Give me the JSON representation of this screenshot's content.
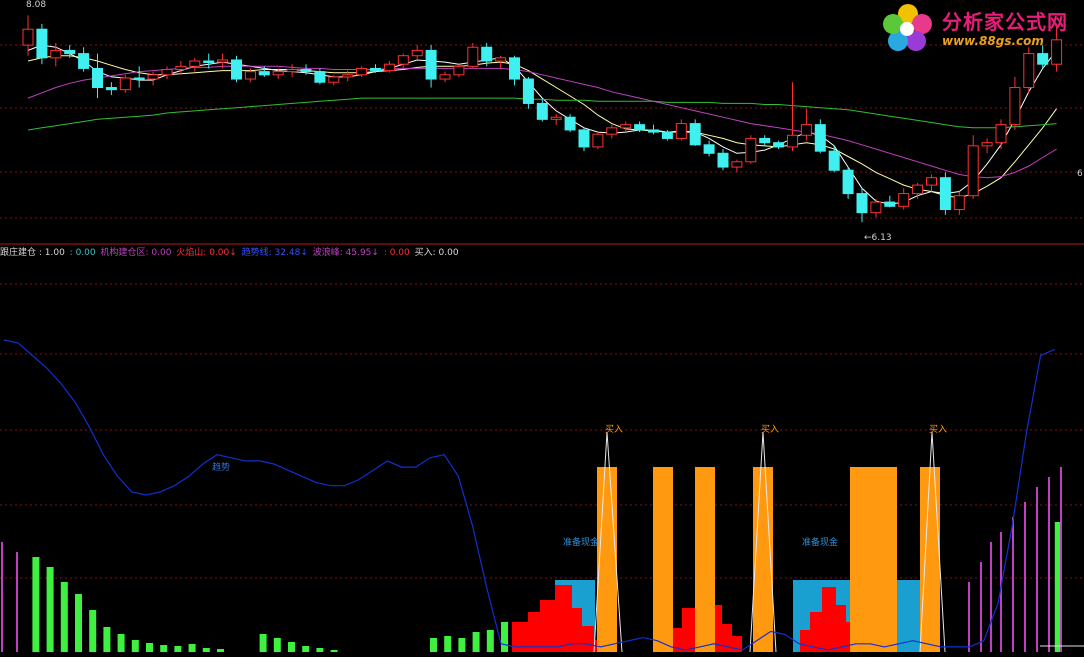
{
  "colors": {
    "up_candle": "#ff3030",
    "down_candle": "#40f0f0",
    "ma5": "#ffffff",
    "ma10": "#ffffaa",
    "ma30": "#c040c0",
    "ma60": "#30c030",
    "gridline": "#8a1010",
    "blue_line": "#1030d0",
    "orange": "#ff9a10",
    "cyan_fill": "#1aa0d0",
    "red_fill": "#ff0000",
    "green_bar": "#40f040",
    "magenta_bar": "#c040c0"
  },
  "price_panel": {
    "high_label": "8.08",
    "low_label": "6.13",
    "right_tick": "6"
  },
  "legend": [
    {
      "text": "跟庄建仓 : 1.00",
      "color": "#d8d8d8"
    },
    {
      "text": ": 0.00",
      "color": "#40c0c0"
    },
    {
      "text": "机构建仓区: 0.00",
      "color": "#c040c0"
    },
    {
      "text": "火焰山: 0.00↓",
      "color": "#ff3030"
    },
    {
      "text": "趋势线: 32.48↓",
      "color": "#3050ff"
    },
    {
      "text": "波浪峰: 45.95↓",
      "color": "#c040c0"
    },
    {
      "text": ": 0.00",
      "color": "#ff3030"
    },
    {
      "text": "买入: 0.00",
      "color": "#d8d8d8"
    }
  ],
  "annotations": {
    "buy_label": "买入",
    "cash_label": "准备现金",
    "trend_label": "趋势"
  },
  "logo": {
    "title": "分析家公式网",
    "url": "www.88gs.com"
  },
  "chart_data": [
    {
      "type": "candlestick",
      "title": "",
      "ylim": [
        6.0,
        8.15
      ],
      "x": [
        0,
        1,
        2,
        3,
        4,
        5,
        6,
        7,
        8,
        9,
        10,
        11,
        12,
        13,
        14,
        15,
        16,
        17,
        18,
        19,
        20,
        21,
        22,
        23,
        24,
        25,
        26,
        27,
        28,
        29,
        30,
        31,
        32,
        33,
        34,
        35,
        36,
        37,
        38,
        39,
        40,
        41,
        42,
        43,
        44,
        45,
        46,
        47,
        48,
        49,
        50,
        51,
        52,
        53,
        54,
        55,
        56,
        57,
        58,
        59,
        60,
        61,
        62,
        63,
        64,
        65,
        66,
        67,
        68,
        69,
        70,
        71,
        72,
        73,
        74
      ],
      "ohlc": [
        [
          7.8,
          8.08,
          7.7,
          7.95
        ],
        [
          7.95,
          8.0,
          7.62,
          7.68
        ],
        [
          7.68,
          7.82,
          7.6,
          7.75
        ],
        [
          7.75,
          7.8,
          7.68,
          7.72
        ],
        [
          7.72,
          7.78,
          7.55,
          7.58
        ],
        [
          7.58,
          7.72,
          7.3,
          7.4
        ],
        [
          7.4,
          7.45,
          7.33,
          7.38
        ],
        [
          7.38,
          7.52,
          7.35,
          7.49
        ],
        [
          7.49,
          7.6,
          7.4,
          7.48
        ],
        [
          7.48,
          7.55,
          7.42,
          7.52
        ],
        [
          7.52,
          7.6,
          7.48,
          7.57
        ],
        [
          7.57,
          7.65,
          7.52,
          7.6
        ],
        [
          7.6,
          7.68,
          7.55,
          7.65
        ],
        [
          7.65,
          7.72,
          7.58,
          7.64
        ],
        [
          7.64,
          7.72,
          7.58,
          7.66
        ],
        [
          7.66,
          7.7,
          7.45,
          7.48
        ],
        [
          7.48,
          7.58,
          7.45,
          7.55
        ],
        [
          7.55,
          7.6,
          7.5,
          7.52
        ],
        [
          7.52,
          7.58,
          7.48,
          7.55
        ],
        [
          7.55,
          7.62,
          7.5,
          7.57
        ],
        [
          7.57,
          7.62,
          7.52,
          7.55
        ],
        [
          7.55,
          7.58,
          7.43,
          7.45
        ],
        [
          7.45,
          7.52,
          7.42,
          7.5
        ],
        [
          7.5,
          7.56,
          7.46,
          7.52
        ],
        [
          7.52,
          7.6,
          7.5,
          7.58
        ],
        [
          7.58,
          7.62,
          7.54,
          7.56
        ],
        [
          7.56,
          7.65,
          7.54,
          7.62
        ],
        [
          7.62,
          7.72,
          7.58,
          7.7
        ],
        [
          7.7,
          7.8,
          7.66,
          7.75
        ],
        [
          7.75,
          7.8,
          7.4,
          7.48
        ],
        [
          7.48,
          7.55,
          7.45,
          7.52
        ],
        [
          7.52,
          7.62,
          7.5,
          7.6
        ],
        [
          7.6,
          7.82,
          7.58,
          7.78
        ],
        [
          7.78,
          7.82,
          7.6,
          7.65
        ],
        [
          7.65,
          7.7,
          7.58,
          7.68
        ],
        [
          7.68,
          7.7,
          7.42,
          7.48
        ],
        [
          7.48,
          7.5,
          7.2,
          7.25
        ],
        [
          7.25,
          7.3,
          7.08,
          7.1
        ],
        [
          7.1,
          7.15,
          7.05,
          7.12
        ],
        [
          7.12,
          7.15,
          6.98,
          7.0
        ],
        [
          7.0,
          7.02,
          6.8,
          6.84
        ],
        [
          6.84,
          6.98,
          6.82,
          6.96
        ],
        [
          6.96,
          7.05,
          6.92,
          7.02
        ],
        [
          7.02,
          7.08,
          6.98,
          7.05
        ],
        [
          7.05,
          7.08,
          6.98,
          7.0
        ],
        [
          7.0,
          7.05,
          6.96,
          6.98
        ],
        [
          6.98,
          7.0,
          6.9,
          6.92
        ],
        [
          6.92,
          7.1,
          6.9,
          7.06
        ],
        [
          7.06,
          7.1,
          6.85,
          6.86
        ],
        [
          6.86,
          6.9,
          6.75,
          6.78
        ],
        [
          6.78,
          6.82,
          6.62,
          6.65
        ],
        [
          6.65,
          6.72,
          6.6,
          6.7
        ],
        [
          6.7,
          6.95,
          6.68,
          6.92
        ],
        [
          6.92,
          6.95,
          6.85,
          6.88
        ],
        [
          6.88,
          6.9,
          6.82,
          6.84
        ],
        [
          6.84,
          7.45,
          6.8,
          6.95
        ],
        [
          6.95,
          7.2,
          6.9,
          7.05
        ],
        [
          7.05,
          7.1,
          6.78,
          6.8
        ],
        [
          6.8,
          6.85,
          6.6,
          6.62
        ],
        [
          6.62,
          6.65,
          6.35,
          6.4
        ],
        [
          6.4,
          6.45,
          6.13,
          6.22
        ],
        [
          6.22,
          6.35,
          6.18,
          6.32
        ],
        [
          6.32,
          6.38,
          6.27,
          6.28
        ],
        [
          6.28,
          6.45,
          6.25,
          6.4
        ],
        [
          6.4,
          6.5,
          6.35,
          6.48
        ],
        [
          6.48,
          6.58,
          6.42,
          6.55
        ],
        [
          6.55,
          6.6,
          6.2,
          6.25
        ],
        [
          6.25,
          6.42,
          6.2,
          6.38
        ],
        [
          6.38,
          6.95,
          6.35,
          6.85
        ],
        [
          6.85,
          6.92,
          6.78,
          6.88
        ],
        [
          6.88,
          7.1,
          6.82,
          7.05
        ],
        [
          7.05,
          7.5,
          7.0,
          7.4
        ],
        [
          7.4,
          7.78,
          7.35,
          7.72
        ],
        [
          7.72,
          7.8,
          7.58,
          7.62
        ],
        [
          7.62,
          8.0,
          7.55,
          7.85
        ]
      ],
      "series": [
        {
          "name": "",
          "values": [
            7.75,
            7.8,
            7.78,
            7.72,
            7.65,
            7.55,
            7.5,
            7.49,
            7.47,
            7.47,
            7.52,
            7.56,
            7.6,
            7.62,
            7.64,
            7.62,
            7.6,
            7.58,
            7.56,
            7.55,
            7.54,
            7.52,
            7.5,
            7.5,
            7.52,
            7.55,
            7.58,
            7.62,
            7.66,
            7.65,
            7.64,
            7.62,
            7.64,
            7.66,
            7.68,
            7.6,
            7.45,
            7.3,
            7.18,
            7.1,
            7.02,
            6.98,
            6.97,
            6.98,
            7.0,
            7.0,
            6.98,
            6.99,
            6.98,
            6.92,
            6.84,
            6.78,
            6.79,
            6.81,
            6.86,
            6.92,
            6.98,
            6.95,
            6.85,
            6.65,
            6.45,
            6.33,
            6.3,
            6.32,
            6.38,
            6.42,
            6.4,
            6.42,
            6.52,
            6.68,
            6.86,
            7.1,
            7.36,
            7.58,
            7.75
          ]
        },
        {
          "name": "",
          "values": [
            7.65,
            7.68,
            7.7,
            7.7,
            7.68,
            7.65,
            7.61,
            7.57,
            7.54,
            7.52,
            7.52,
            7.53,
            7.54,
            7.55,
            7.56,
            7.56,
            7.56,
            7.57,
            7.57,
            7.57,
            7.56,
            7.55,
            7.54,
            7.54,
            7.54,
            7.55,
            7.56,
            7.57,
            7.59,
            7.6,
            7.6,
            7.6,
            7.61,
            7.63,
            7.64,
            7.62,
            7.56,
            7.48,
            7.4,
            7.32,
            7.24,
            7.14,
            7.06,
            7.01,
            7.0,
            6.99,
            6.98,
            6.98,
            6.98,
            6.95,
            6.92,
            6.88,
            6.86,
            6.85,
            6.84,
            6.86,
            6.88,
            6.86,
            6.82,
            6.75,
            6.68,
            6.6,
            6.54,
            6.48,
            6.44,
            6.42,
            6.38,
            6.36,
            6.4,
            6.47,
            6.55,
            6.7,
            6.86,
            7.02,
            7.2
          ]
        },
        {
          "name": "",
          "values": [
            7.3,
            7.35,
            7.4,
            7.44,
            7.47,
            7.49,
            7.51,
            7.53,
            7.55,
            7.56,
            7.57,
            7.58,
            7.59,
            7.59,
            7.6,
            7.6,
            7.6,
            7.6,
            7.6,
            7.59,
            7.58,
            7.58,
            7.57,
            7.57,
            7.57,
            7.57,
            7.58,
            7.58,
            7.58,
            7.58,
            7.58,
            7.58,
            7.58,
            7.58,
            7.58,
            7.57,
            7.55,
            7.52,
            7.49,
            7.46,
            7.43,
            7.4,
            7.36,
            7.33,
            7.3,
            7.27,
            7.24,
            7.21,
            7.18,
            7.15,
            7.12,
            7.09,
            7.06,
            7.04,
            7.02,
            7.0,
            6.98,
            6.96,
            6.93,
            6.9,
            6.86,
            6.82,
            6.78,
            6.74,
            6.7,
            6.66,
            6.62,
            6.58,
            6.56,
            6.55,
            6.56,
            6.6,
            6.66,
            6.74,
            6.82
          ]
        },
        {
          "name": "",
          "values": [
            7.0,
            7.02,
            7.04,
            7.06,
            7.08,
            7.1,
            7.11,
            7.12,
            7.13,
            7.14,
            7.16,
            7.17,
            7.18,
            7.19,
            7.2,
            7.21,
            7.22,
            7.23,
            7.24,
            7.25,
            7.26,
            7.27,
            7.28,
            7.29,
            7.3,
            7.3,
            7.3,
            7.3,
            7.3,
            7.3,
            7.3,
            7.3,
            7.3,
            7.3,
            7.3,
            7.3,
            7.29,
            7.29,
            7.28,
            7.28,
            7.28,
            7.27,
            7.27,
            7.27,
            7.27,
            7.27,
            7.26,
            7.26,
            7.26,
            7.26,
            7.25,
            7.25,
            7.25,
            7.24,
            7.24,
            7.23,
            7.22,
            7.21,
            7.2,
            7.19,
            7.17,
            7.15,
            7.13,
            7.11,
            7.09,
            7.07,
            7.05,
            7.03,
            7.02,
            7.02,
            7.02,
            7.03,
            7.04,
            7.05,
            7.06
          ]
        }
      ]
    },
    {
      "type": "area",
      "title": "",
      "ylim": [
        0,
        100
      ],
      "x": [
        0,
        1,
        2,
        3,
        4,
        5,
        6,
        7,
        8,
        9,
        10,
        11,
        12,
        13,
        14,
        15,
        16,
        17,
        18,
        19,
        20,
        21,
        22,
        23,
        24,
        25,
        26,
        27,
        28,
        29,
        30,
        31,
        32,
        33,
        34,
        35,
        36,
        37,
        38,
        39,
        40,
        41,
        42,
        43,
        44,
        45,
        46,
        47,
        48,
        49,
        50,
        51,
        52,
        53,
        54,
        55,
        56,
        57,
        58,
        59,
        60,
        61,
        62,
        63,
        64,
        65,
        66,
        67,
        68,
        69,
        70,
        71,
        72,
        73,
        74
      ],
      "series": [
        {
          "name": "趋势线",
          "values": [
            100,
            99,
            95,
            91,
            86,
            80,
            72,
            63,
            56,
            51,
            50,
            51,
            53,
            56,
            60,
            63,
            62,
            61,
            61,
            60,
            58,
            56,
            54,
            53,
            53,
            55,
            58,
            61,
            59,
            59,
            62,
            63,
            56,
            40,
            20,
            2,
            1,
            1,
            1,
            1,
            2,
            2,
            1,
            2,
            3,
            4,
            3,
            1,
            0,
            1,
            2,
            1,
            0,
            3,
            6,
            5,
            2,
            1,
            0,
            1,
            2,
            2,
            1,
            2,
            3,
            2,
            1,
            1,
            1,
            3,
            15,
            40,
            70,
            95,
            97
          ]
        },
        {
          "name": "波浪峰",
          "values": [
            0,
            0,
            0,
            0,
            0,
            0,
            0,
            0,
            0,
            0,
            0,
            0,
            0,
            0,
            0,
            0,
            0,
            0,
            0,
            0,
            0,
            0,
            0,
            0,
            0,
            0,
            0,
            0,
            0,
            0,
            0,
            0,
            0,
            0,
            0,
            0,
            0,
            0,
            0,
            0,
            0,
            80,
            0,
            0,
            0,
            0,
            0,
            0,
            0,
            0,
            0,
            0,
            80,
            0,
            0,
            0,
            0,
            0,
            0,
            0,
            0,
            0,
            0,
            0,
            80,
            0,
            0,
            0,
            0,
            0,
            0,
            0,
            0,
            0,
            0
          ]
        }
      ]
    }
  ]
}
